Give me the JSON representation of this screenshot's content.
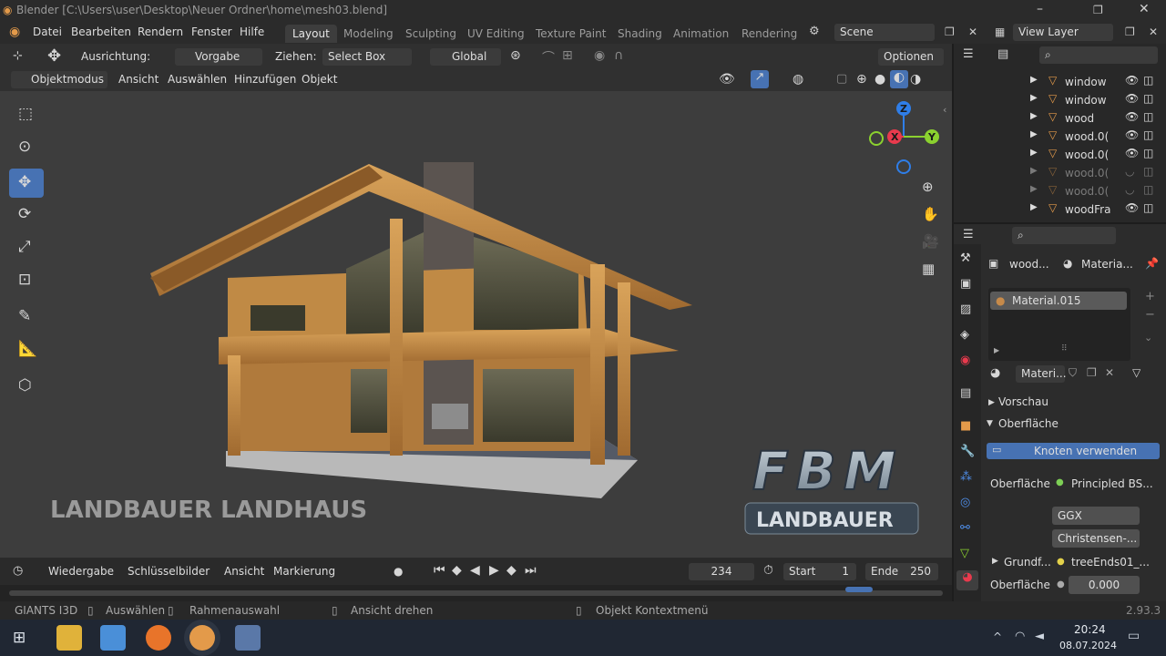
{
  "window": {
    "title": "Blender [C:\\Users\\user\\Desktop\\Neuer Ordner\\home\\mesh03.blend]"
  },
  "menu": {
    "items": [
      "Datei",
      "Bearbeiten",
      "Rendern",
      "Fenster",
      "Hilfe"
    ]
  },
  "workspaces": [
    "Layout",
    "Modeling",
    "Sculpting",
    "UV Editing",
    "Texture Paint",
    "Shading",
    "Animation",
    "Rendering"
  ],
  "scene": {
    "name": "Scene",
    "view_layer": "View Layer"
  },
  "tool_header": {
    "orientation_label": "Ausrichtung:",
    "orientation_value": "Vorgabe",
    "drag_label": "Ziehen:",
    "drag_value": "Select Box",
    "transform_space": "Global",
    "options": "Optionen"
  },
  "mode_header": {
    "mode": "Objektmodus",
    "items": [
      "Ansicht",
      "Auswählen",
      "Hinzufügen",
      "Objekt"
    ]
  },
  "gizmo": {
    "z": "Z",
    "x": "X",
    "y": "Y"
  },
  "overlay_text": {
    "title": "LANDBAUER LANDHAUS",
    "logo_big": "FBM",
    "logo_small": "LANDBAUER"
  },
  "timeline": {
    "playback": "Wiedergabe",
    "keyframes": "Schlüsselbilder",
    "view": "Ansicht",
    "marker": "Markierung",
    "current_frame": "234",
    "start_label": "Start",
    "start": "1",
    "end_label": "Ende",
    "end": "250"
  },
  "status": {
    "addon": "GIANTS I3D",
    "select": "Auswählen",
    "box_select": "Rahmenauswahl",
    "rotate": "Ansicht drehen",
    "context": "Objekt Kontextmenü",
    "version": "2.93.3"
  },
  "outliner": {
    "items": [
      {
        "name": "window",
        "dim": false
      },
      {
        "name": "window",
        "dim": false
      },
      {
        "name": "wood",
        "dim": false
      },
      {
        "name": "wood.0(",
        "dim": false
      },
      {
        "name": "wood.0(",
        "dim": false
      },
      {
        "name": "wood.0(",
        "dim": true
      },
      {
        "name": "wood.0(",
        "dim": true
      },
      {
        "name": "woodFra",
        "dim": false
      }
    ]
  },
  "properties": {
    "object_name": "wood...",
    "material_name_short": "Materia...",
    "slot": "Material.015",
    "mat_field": "Materi...",
    "preview": "Vorschau",
    "surface_panel": "Oberfläche",
    "use_nodes": "Knoten verwenden",
    "surface_label": "Oberfläche",
    "surface_value": "Principled BS...",
    "distribution": "GGX",
    "subsurface": "Christensen-...",
    "base_color_label": "Grundf...",
    "base_color_value": "treeEnds01_...",
    "value_label": "Oberfläche",
    "value": "0.000"
  },
  "taskbar": {
    "time": "20:24",
    "date": "08.07.2024"
  },
  "colors": {
    "accent": "#4772b3",
    "orange": "#e39a4a",
    "x_axis": "#e83a4d",
    "y_axis": "#8bd12f",
    "z_axis": "#2f7ee8"
  }
}
